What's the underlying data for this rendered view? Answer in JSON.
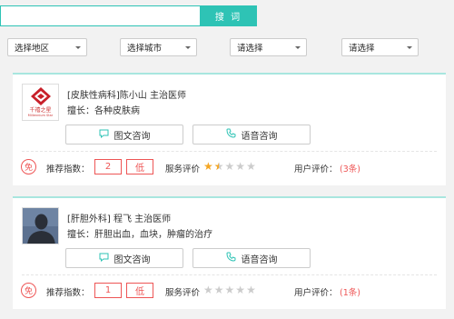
{
  "search": {
    "placeholder": "",
    "button_label": "搜 词"
  },
  "filters": [
    "选择地区",
    "选择城市",
    "请选择",
    "请选择"
  ],
  "consult": {
    "text_label": "图文咨询",
    "voice_label": "语音咨询"
  },
  "labels": {
    "index": "推荐指数：",
    "service": "服务评价",
    "user": "用户评价："
  },
  "doctors": [
    {
      "title": "[皮肤性病科]陈小山 主治医师",
      "specialty": "擅长：各种皮肤病",
      "free_badge": "免",
      "index_value": "2",
      "index_level": "低",
      "rating_stars": 1.5,
      "user_reviews": "(3条)",
      "avatar": "hospital-logo",
      "logo_text": "千禧之星",
      "logo_sub": "Millennium Star"
    },
    {
      "title": "[肝胆外科] 程飞 主治医师",
      "specialty": "擅长：肝胆出血，血块，肿瘤的治疗",
      "free_badge": "免",
      "index_value": "1",
      "index_level": "低",
      "rating_stars": 0,
      "user_reviews": "(1条)",
      "avatar": "default-person"
    }
  ],
  "colors": {
    "accent": "#2ec3b5",
    "red": "#e55555",
    "star": "#f5a623"
  }
}
